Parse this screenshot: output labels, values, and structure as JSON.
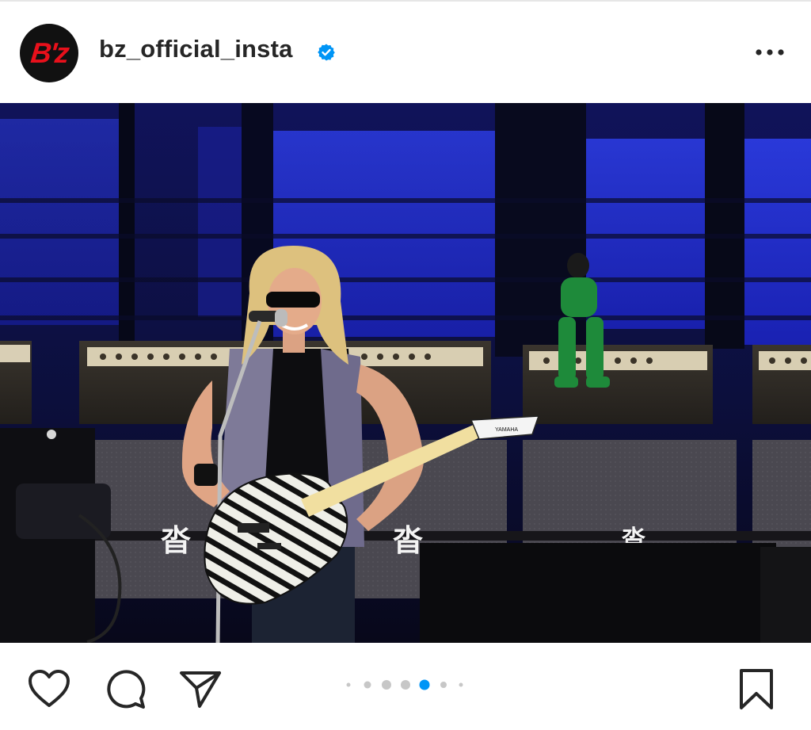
{
  "post": {
    "username": "bz_official_insta",
    "verified": true,
    "avatar_logo_text": "B'z",
    "more_icon": "more-horizontal-icon"
  },
  "photo": {
    "stage_marks": [
      "沓",
      "沓",
      "沓"
    ],
    "guitar_brand": "YAMAHA"
  },
  "carousel": {
    "dot_count": 7,
    "active_index": 4
  },
  "actions": {
    "like_icon": "heart-icon",
    "comment_icon": "comment-icon",
    "share_icon": "paper-plane-icon",
    "save_icon": "bookmark-icon"
  },
  "colors": {
    "active_dot": "#0095f6",
    "inactive_dot": "#c7c7c7",
    "verified": "#0095f6",
    "brand_red": "#e8101b"
  }
}
